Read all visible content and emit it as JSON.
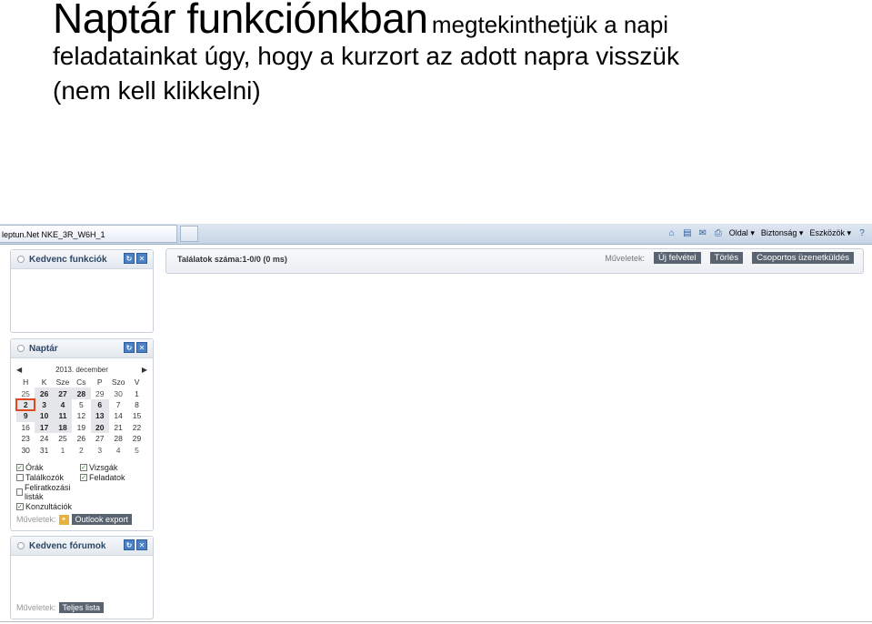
{
  "slide": {
    "title_big": "Naptár funkciónkban",
    "title_small": "megtekinthetjük a napi",
    "line2": "feladatainkat úgy, hogy a kurzort az adott napra visszük",
    "line3": "(nem kell klikkelni)"
  },
  "browser": {
    "tab_label": "leptun.Net NKE_3R_W6H_1",
    "menu_page": "Oldal",
    "menu_security": "Biztonság",
    "menu_tools": "Eszközök",
    "help_glyph": "?",
    "dropdown_glyph": "▾",
    "icons": [
      "home-icon",
      "feed-icon",
      "mail-icon",
      "print-icon",
      "help-icon"
    ]
  },
  "favorites_panel": {
    "title": "Kedvenc funkciók"
  },
  "calendar_panel": {
    "title": "Naptár",
    "month_label": "2013. december",
    "prev_glyph": "◀",
    "next_glyph": "▶",
    "weekdays": [
      "H",
      "K",
      "Sze",
      "Cs",
      "P",
      "Szo",
      "V"
    ],
    "weeks": [
      [
        {
          "d": "25",
          "t": "other"
        },
        {
          "d": "26",
          "t": "busy"
        },
        {
          "d": "27",
          "t": "busy"
        },
        {
          "d": "28",
          "t": "busy"
        },
        {
          "d": "29",
          "t": "other"
        },
        {
          "d": "30",
          "t": "other"
        },
        {
          "d": "1",
          "t": "normal"
        }
      ],
      [
        {
          "d": "2",
          "t": "busy_hl"
        },
        {
          "d": "3",
          "t": "busy"
        },
        {
          "d": "4",
          "t": "busy"
        },
        {
          "d": "5",
          "t": "normal"
        },
        {
          "d": "6",
          "t": "busy"
        },
        {
          "d": "7",
          "t": "normal"
        },
        {
          "d": "8",
          "t": "normal"
        }
      ],
      [
        {
          "d": "9",
          "t": "busy"
        },
        {
          "d": "10",
          "t": "busy"
        },
        {
          "d": "11",
          "t": "busy"
        },
        {
          "d": "12",
          "t": "normal"
        },
        {
          "d": "13",
          "t": "busy"
        },
        {
          "d": "14",
          "t": "normal"
        },
        {
          "d": "15",
          "t": "normal"
        }
      ],
      [
        {
          "d": "16",
          "t": "normal"
        },
        {
          "d": "17",
          "t": "busy"
        },
        {
          "d": "18",
          "t": "busy"
        },
        {
          "d": "19",
          "t": "normal"
        },
        {
          "d": "20",
          "t": "busy"
        },
        {
          "d": "21",
          "t": "normal"
        },
        {
          "d": "22",
          "t": "normal"
        }
      ],
      [
        {
          "d": "23",
          "t": "normal"
        },
        {
          "d": "24",
          "t": "normal"
        },
        {
          "d": "25",
          "t": "normal"
        },
        {
          "d": "26",
          "t": "normal"
        },
        {
          "d": "27",
          "t": "normal"
        },
        {
          "d": "28",
          "t": "normal"
        },
        {
          "d": "29",
          "t": "normal"
        }
      ],
      [
        {
          "d": "30",
          "t": "normal"
        },
        {
          "d": "31",
          "t": "normal"
        },
        {
          "d": "1",
          "t": "other"
        },
        {
          "d": "2",
          "t": "other"
        },
        {
          "d": "3",
          "t": "other"
        },
        {
          "d": "4",
          "t": "other"
        },
        {
          "d": "5",
          "t": "other"
        }
      ]
    ],
    "filters": [
      {
        "label": "Órák",
        "checked": true
      },
      {
        "label": "Vizsgák",
        "checked": true
      },
      {
        "label": "Találkozók",
        "checked": false
      },
      {
        "label": "Feladatok",
        "checked": true
      },
      {
        "label": "Feliratkozási listák",
        "checked": false
      },
      {
        "label": "",
        "checked": null
      },
      {
        "label": "Konzultációk",
        "checked": true
      }
    ],
    "ops_label": "Műveletek:",
    "export_button": "Outlook export"
  },
  "forums_panel": {
    "title": "Kedvenc fórumok",
    "ops_label": "Műveletek:",
    "list_button": "Teljes lista"
  },
  "results": {
    "count_text": "Találatok száma:1-0/0 (0 ms)",
    "ops_label": "Műveletek:",
    "new_button": "Új felvétel",
    "delete_button": "Törlés",
    "group_message_button": "Csoportos üzenetküldés"
  },
  "colors": {
    "highlight": "#e04a22",
    "button_bg": "#5a6470",
    "panel_title": "#2c4766"
  }
}
